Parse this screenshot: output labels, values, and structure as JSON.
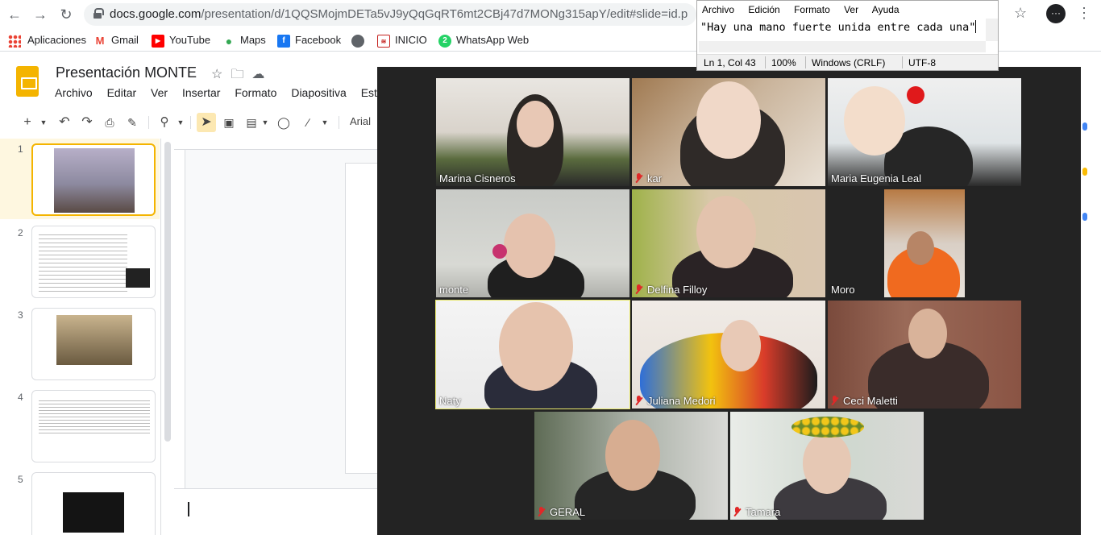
{
  "browser": {
    "url_host": "docs.google.com",
    "url_path": "/presentation/d/1QQSMojmDETa5vJ9yQqGqRT6mt2CBj47d7MONg315apY/edit#slide=id.p",
    "bookmarks": [
      {
        "label": "Aplicaciones",
        "icon": "apps-grid-icon"
      },
      {
        "label": "Gmail",
        "icon": "gmail-icon",
        "color": "#ea4335"
      },
      {
        "label": "YouTube",
        "icon": "youtube-icon",
        "color": "#ff0000"
      },
      {
        "label": "Maps",
        "icon": "maps-pin-icon",
        "color": "#34a853"
      },
      {
        "label": "Facebook",
        "icon": "facebook-icon",
        "color": "#1877f2"
      },
      {
        "label": "",
        "icon": "globe-icon",
        "color": "#5f6368"
      },
      {
        "label": "INICIO",
        "icon": "inicio-icon",
        "color": "#c5221f"
      },
      {
        "label": "WhatsApp Web",
        "icon": "whatsapp-icon",
        "color": "#25d366"
      }
    ]
  },
  "slides": {
    "title": "Presentación MONTE",
    "menu": [
      "Archivo",
      "Editar",
      "Ver",
      "Insertar",
      "Formato",
      "Diapositiva",
      "Estru"
    ],
    "font": "Arial",
    "slide_numbers": [
      "1",
      "2",
      "3",
      "4",
      "5"
    ]
  },
  "notepad": {
    "menu": [
      "Archivo",
      "Edición",
      "Formato",
      "Ver",
      "Ayuda"
    ],
    "text": "\"Hay una mano fuerte unida entre cada una\"",
    "status": {
      "position": "Ln 1, Col 43",
      "zoom": "100%",
      "line_ending": "Windows (CRLF)",
      "encoding": "UTF-8"
    }
  },
  "zoom": {
    "participants": [
      {
        "name": "Marina Cisneros",
        "muted": false
      },
      {
        "name": "kar",
        "muted": true
      },
      {
        "name": "Maria Eugenia Leal",
        "muted": false
      },
      {
        "name": "monte",
        "muted": false
      },
      {
        "name": "Delfina Filloy",
        "muted": true
      },
      {
        "name": "Moro",
        "muted": false
      },
      {
        "name": "Naty",
        "muted": false
      },
      {
        "name": "Juliana Medori",
        "muted": true
      },
      {
        "name": "Ceci Maletti",
        "muted": true
      },
      {
        "name": "GERAL",
        "muted": true
      },
      {
        "name": "Tamara",
        "muted": true
      }
    ]
  },
  "colors": {
    "slides_accent": "#f4b400",
    "zoom_bg": "#232323",
    "mute_red": "#e02828",
    "active_speaker": "#e8e86a"
  }
}
